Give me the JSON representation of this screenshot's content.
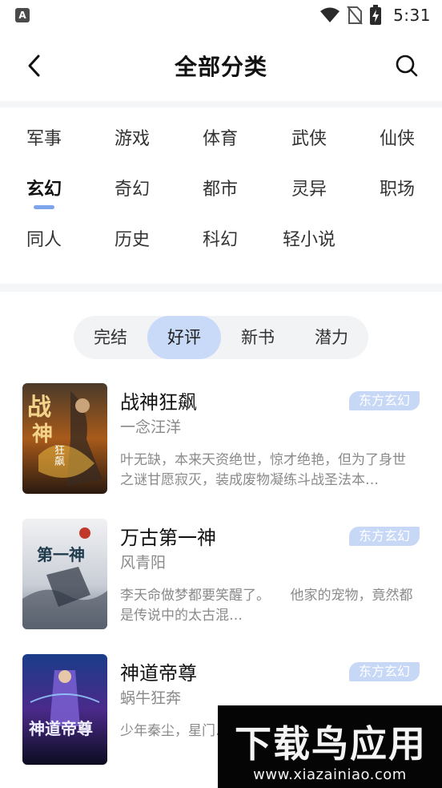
{
  "status_bar": {
    "app_icon_letter": "A",
    "time": "5:31",
    "icons": [
      "wifi-icon",
      "no-sim-icon",
      "battery-charging-icon"
    ]
  },
  "header": {
    "title": "全部分类",
    "back_icon": "chevron-left-icon",
    "search_icon": "search-icon"
  },
  "categories": {
    "rows": [
      [
        "军事",
        "游戏",
        "体育",
        "武侠",
        "仙侠"
      ],
      [
        "玄幻",
        "奇幻",
        "都市",
        "灵异",
        "职场"
      ],
      [
        "同人",
        "历史",
        "科幻",
        "轻小说"
      ]
    ],
    "active": "玄幻"
  },
  "filters": {
    "tabs": [
      "完结",
      "好评",
      "新书",
      "潜力"
    ],
    "active": "好评"
  },
  "books": [
    {
      "title": "战神狂飙",
      "author": "一念汪洋",
      "tag": "东方玄幻",
      "desc": "叶无缺，本来天资绝世，惊才绝艳，但为了身世之谜甘愿寂灭，装成废物凝练斗战圣法本…",
      "cover_text": "战神 狂飙"
    },
    {
      "title": "万古第一神",
      "author": "风青阳",
      "tag": "东方玄幻",
      "desc": "李天命做梦都要笑醒了。　　他家的宠物，竟然都是传说中的太古混…",
      "cover_text": "第一神"
    },
    {
      "title": "神道帝尊",
      "author": "蜗牛狂奔",
      "tag": "东方玄幻",
      "desc": "少年秦尘，星门…醒九生九世记忆…",
      "cover_text": "神道帝尊"
    }
  ],
  "watermark": {
    "logo": "下载鸟应用",
    "url": "www.xiazainiao.com"
  },
  "colors": {
    "accent": "#7da5ec",
    "active_pill": "#c9daf8",
    "tag_bg": "#c7d8f6",
    "divider": "#f5f6f8"
  }
}
